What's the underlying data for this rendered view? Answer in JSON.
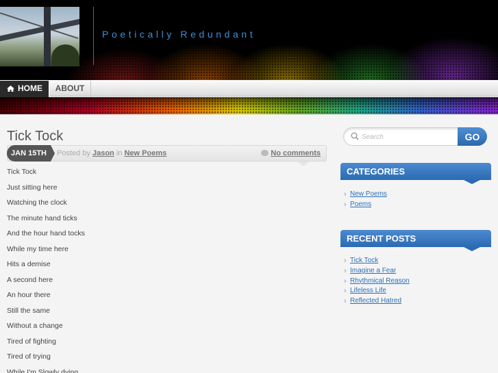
{
  "site": {
    "title": "Poetically Redundant"
  },
  "nav": {
    "items": [
      {
        "label": "Home"
      },
      {
        "label": "About"
      }
    ]
  },
  "post": {
    "title": "Tick Tock",
    "date": "JAN 15TH",
    "posted_by_prefix": "Posted by",
    "author": "Jason",
    "in_word": "in",
    "category": "New Poems",
    "comments_label": "No comments",
    "lines": [
      "Tick Tock",
      "Just sitting here",
      "Watching the clock",
      "The minute hand ticks",
      "And the hour hand tocks",
      "While my time here",
      "Hits a demise",
      "A second here",
      "An hour there",
      "Still the same",
      "Without a change",
      "Tired of fighting",
      "Tired of trying",
      "While I'm Slowly dying"
    ]
  },
  "search": {
    "placeholder": "Search",
    "button_label": "GO"
  },
  "categories": {
    "heading": "CATEGORIES",
    "items": [
      "New Poems",
      "Poems"
    ]
  },
  "recent_posts": {
    "heading": "RECENT POSTS",
    "items": [
      "Tick Tock",
      "Imagine a Fear",
      "Rhythmical Reason",
      "Lifeless Life",
      "Reflected Hatred"
    ]
  },
  "colors": {
    "accent": "#3d8fd6",
    "widget_blue": "#2c6bb2",
    "nav_active": "#2a2a2a"
  }
}
